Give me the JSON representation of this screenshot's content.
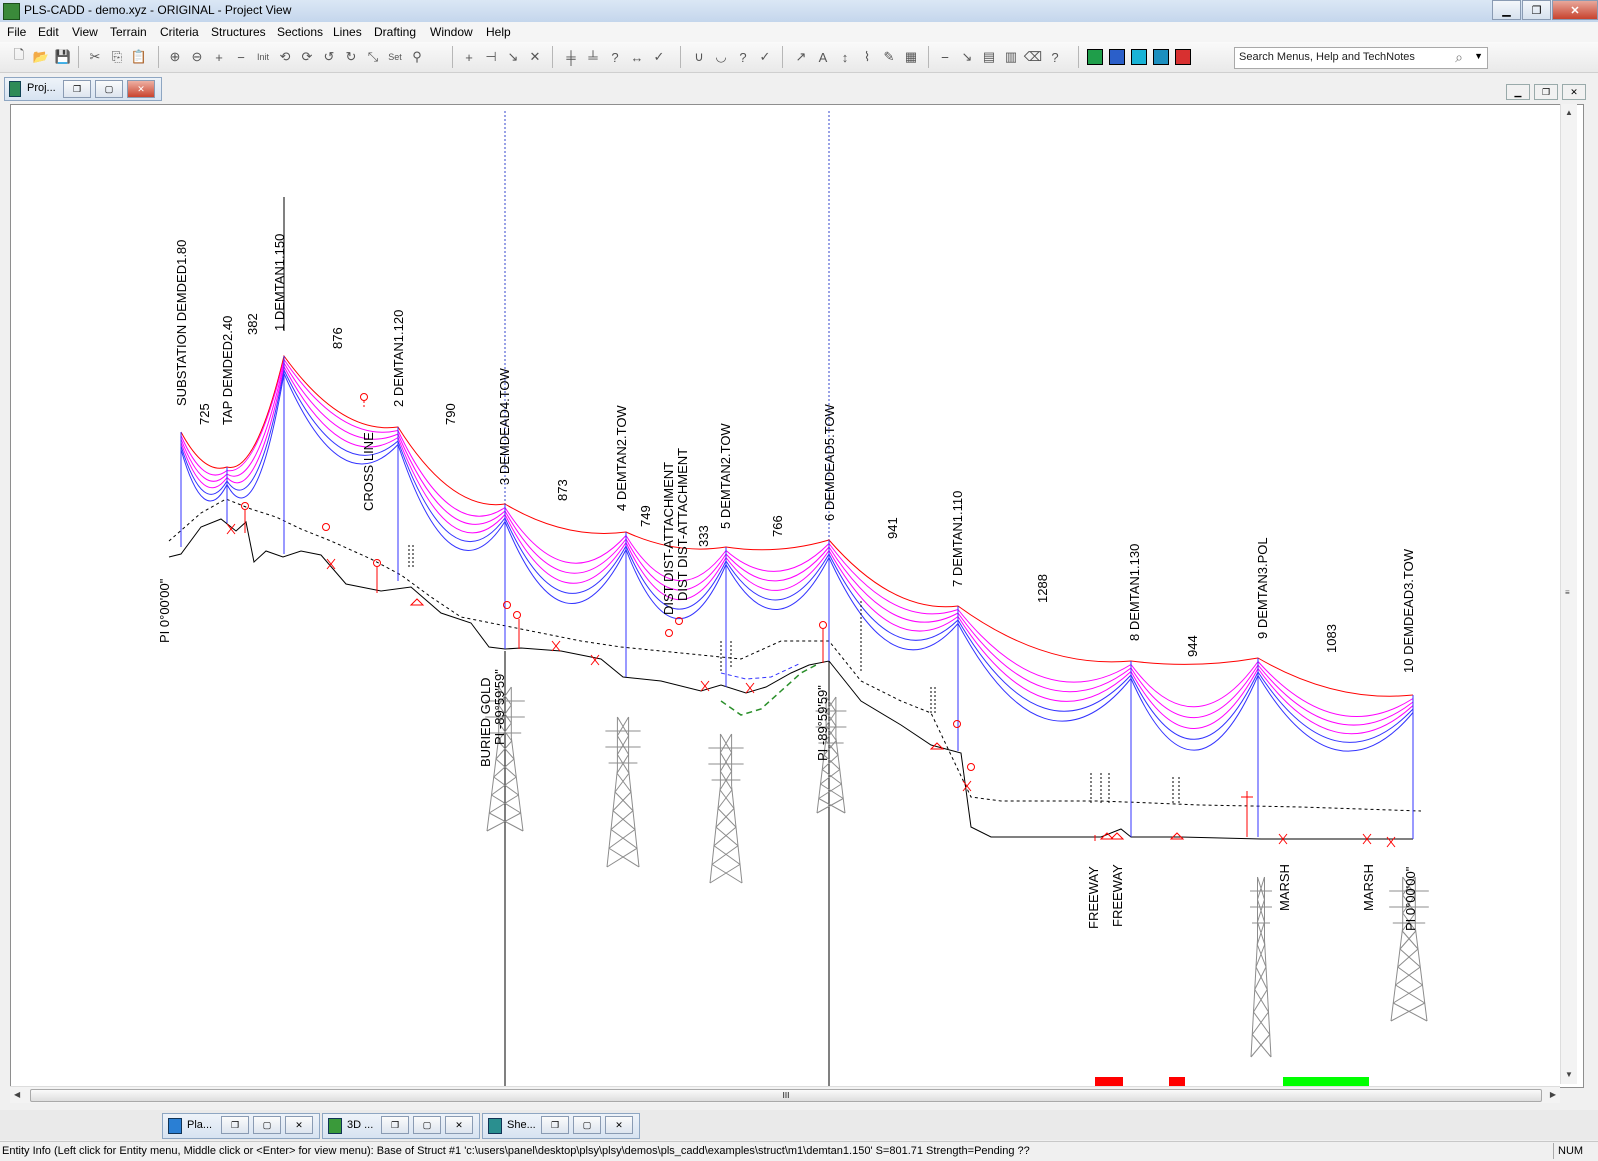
{
  "window": {
    "title": "PLS-CADD - demo.xyz - ORIGINAL - Project View",
    "minimize_label": "▁",
    "restore_label": "❐",
    "close_label": "✕"
  },
  "menu": [
    "File",
    "Edit",
    "View",
    "Terrain",
    "Criteria",
    "Structures",
    "Sections",
    "Lines",
    "Drafting",
    "Window",
    "Help"
  ],
  "toolbar": {
    "init_label": "Init",
    "set_label": "Set",
    "search_placeholder": "Search Menus, Help and TechNotes"
  },
  "mdi_tab": {
    "label": "Proj..."
  },
  "profile": {
    "structures": [
      {
        "label": "SUBSTATION DEMDED1.80"
      },
      {
        "label": "TAP DEMDED2.40"
      },
      {
        "label": "1 DEMTAN1.150"
      },
      {
        "label": "2 DEMTAN1.120"
      },
      {
        "label": "3 DEMDEAD4.TOW"
      },
      {
        "label": "4 DEMTAN2.TOW"
      },
      {
        "label": "5 DEMTAN2.TOW"
      },
      {
        "label": "6 DEMDEAD5.TOW"
      },
      {
        "label": "7 DEMTAN1.110"
      },
      {
        "label": "8 DEMTAN1.130"
      },
      {
        "label": "9 DEMTAN3.POL"
      },
      {
        "label": "10 DEMDEAD3.TOW"
      }
    ],
    "span_lengths": [
      "725",
      "382",
      "876",
      "790",
      "873",
      "749",
      "333",
      "766",
      "941",
      "1288",
      "944",
      "1083"
    ],
    "crossings": [
      {
        "label": "CROSS LINE"
      },
      {
        "label": "DIST DIST-ATTACHMENT"
      },
      {
        "label": "DIST DIST-ATTACHMENT"
      },
      {
        "label": "BURIED GOLD"
      },
      {
        "label": "FREEWAY"
      },
      {
        "label": "FREEWAY"
      },
      {
        "label": "MARSH"
      },
      {
        "label": "MARSH"
      }
    ],
    "pi_labels": [
      "PI 0°00'00\"",
      "PI -89°59'59\"",
      "PI -89°59'59\"",
      "PI 0°00'00\""
    ],
    "colors": {
      "ruling": "#ff0000",
      "hot": "#ff00ff",
      "cold": "#3333ff",
      "ground": "#000000",
      "clearance": "#000000",
      "violation_red": "#ff0000",
      "ok_green": "#00ff00"
    }
  },
  "scroll": {
    "grip": "III"
  },
  "taskbar": [
    {
      "label": "Pla...",
      "color": "#2a7fd4"
    },
    {
      "label": "3D ...",
      "color": "#3a9a3a"
    },
    {
      "label": "She...",
      "color": "#2a8f8f"
    }
  ],
  "status": {
    "text": "Entity Info (Left click for Entity menu, Middle click or <Enter> for view menu):  Base of Struct #1 'c:\\users\\panel\\desktop\\plsy\\plsy\\demos\\pls_cadd\\examples\\struct\\m1\\demtan1.150' S=801.71 Strength=Pending  ??",
    "num": "NUM"
  }
}
